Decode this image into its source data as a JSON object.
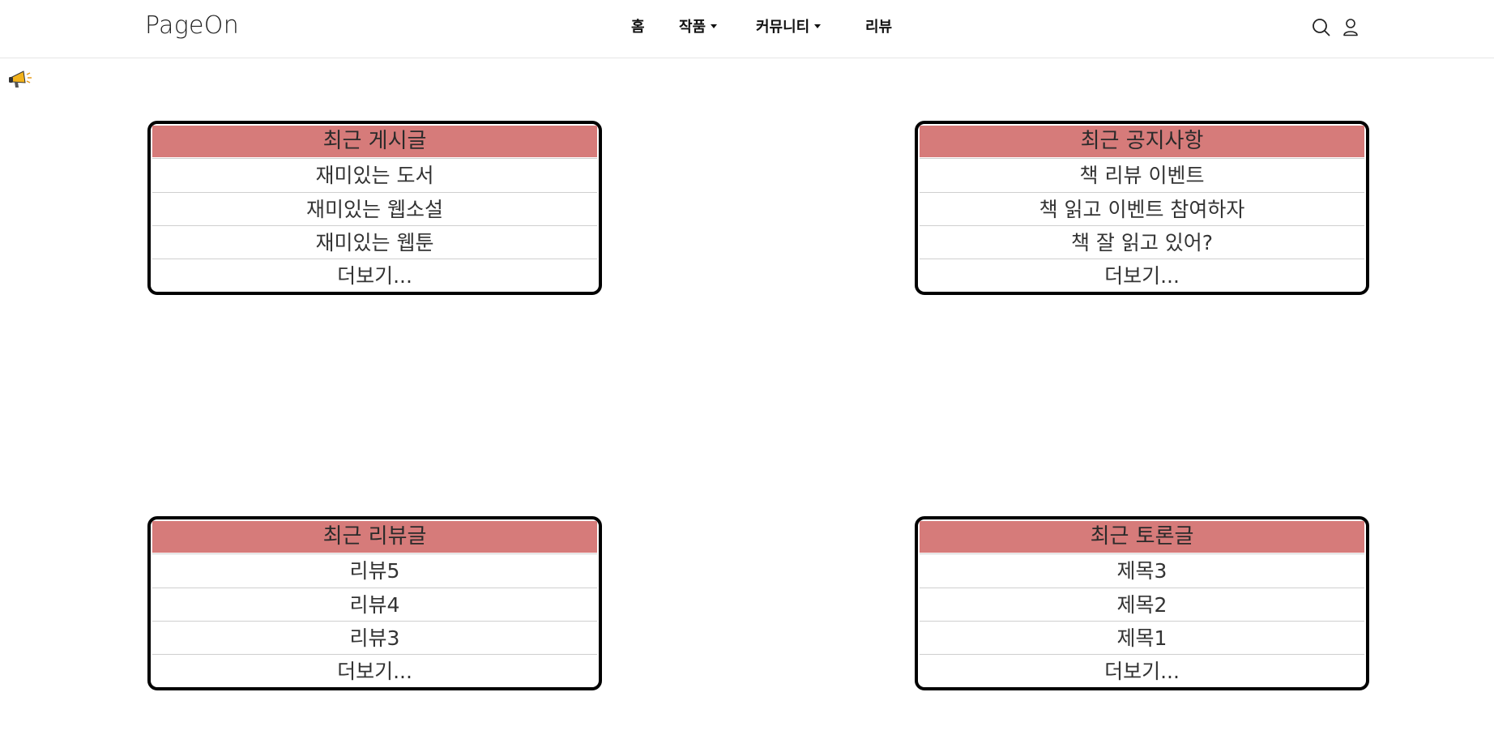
{
  "brand": "PageOn",
  "nav": {
    "home": "홈",
    "works": "작품",
    "community": "커뮤니티",
    "review": "리뷰"
  },
  "icons": {
    "search": "search-icon",
    "user": "user-icon",
    "notice": "megaphone-icon"
  },
  "boards": {
    "recent_posts": {
      "title": "최근 게시글",
      "items": [
        "재미있는 도서",
        "재미있는 웹소설",
        "재미있는 웹툰"
      ],
      "more": "더보기..."
    },
    "recent_notices": {
      "title": "최근 공지사항",
      "items": [
        "책 리뷰 이벤트",
        "책 읽고 이벤트 참여하자",
        "책 잘 읽고 있어?"
      ],
      "more": "더보기..."
    },
    "recent_reviews": {
      "title": "최근 리뷰글",
      "items": [
        "리뷰5",
        "리뷰4",
        "리뷰3"
      ],
      "more": "더보기..."
    },
    "recent_discussions": {
      "title": "최근 토론글",
      "items": [
        "제목3",
        "제목2",
        "제목1"
      ],
      "more": "더보기..."
    }
  },
  "colors": {
    "board_header": "#d67b7a",
    "board_border": "#000000",
    "divider": "#e6e6e6"
  }
}
